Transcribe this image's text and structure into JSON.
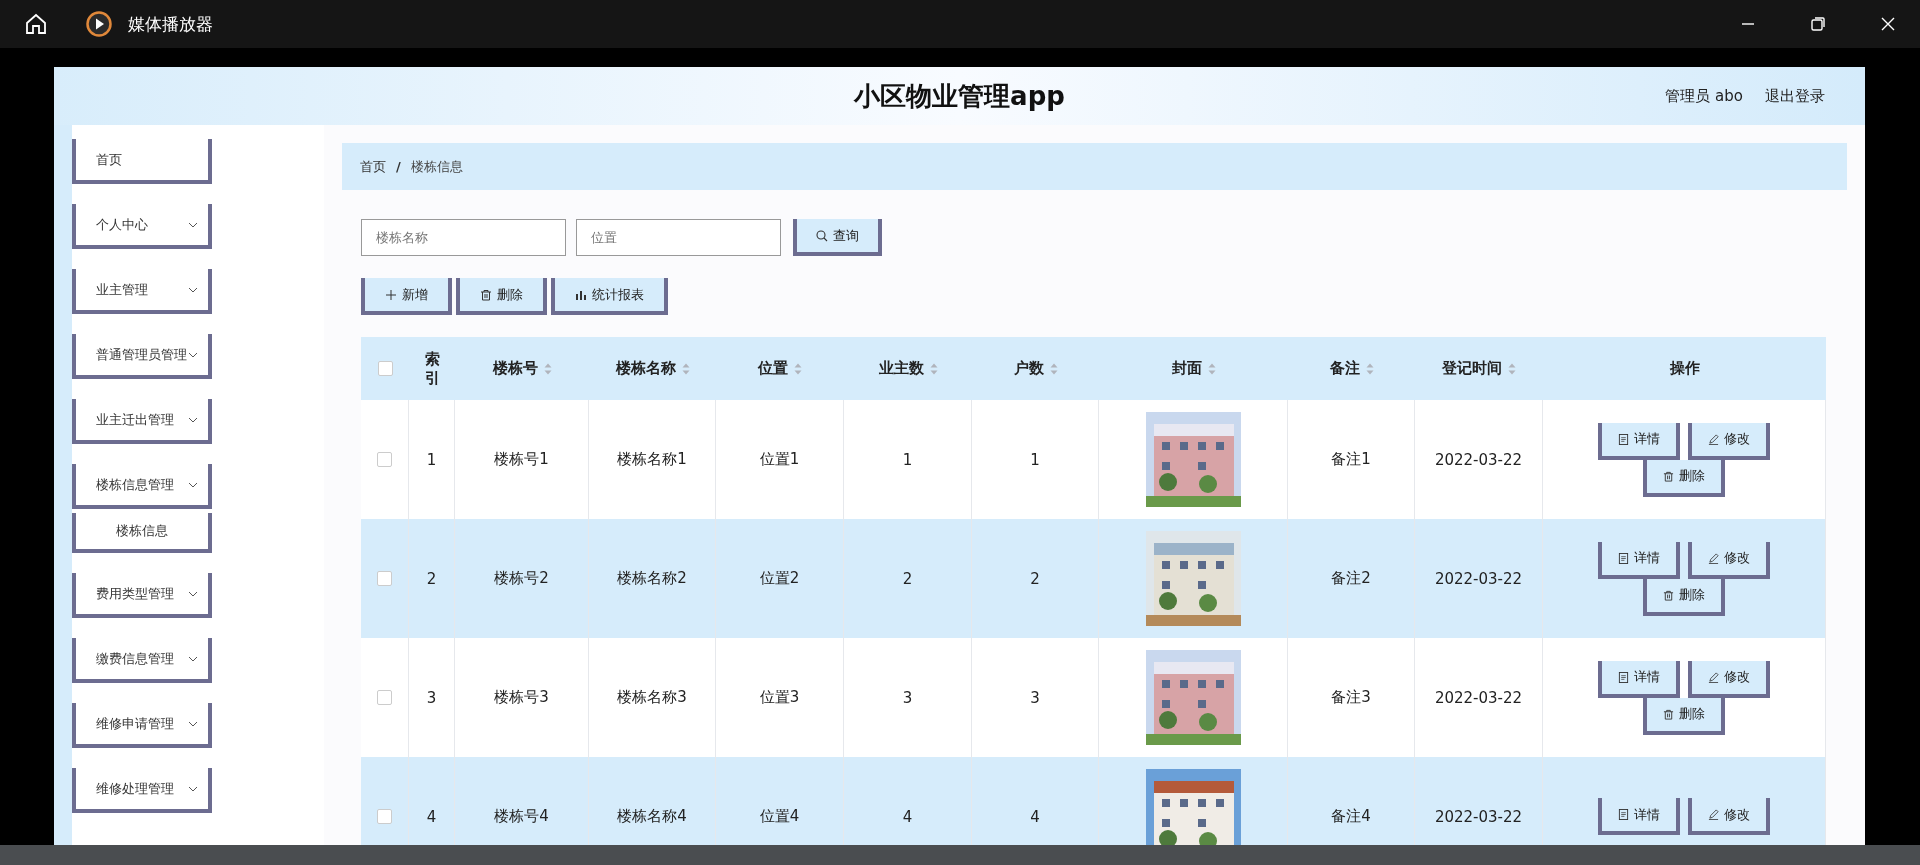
{
  "player": {
    "title": "媒体播放器"
  },
  "app": {
    "title": "小区物业管理app",
    "user": "管理员 abo",
    "logout": "退出登录"
  },
  "sidebar": {
    "items": [
      {
        "label": "首页",
        "kind": "link"
      },
      {
        "label": "个人中心",
        "kind": "menu"
      },
      {
        "label": "业主管理",
        "kind": "menu"
      },
      {
        "label": "普通管理员管理",
        "kind": "menu"
      },
      {
        "label": "业主迁出管理",
        "kind": "menu"
      },
      {
        "label": "楼栋信息管理",
        "kind": "menu",
        "children": [
          {
            "label": "楼栋信息"
          }
        ]
      },
      {
        "label": "费用类型管理",
        "kind": "menu"
      },
      {
        "label": "缴费信息管理",
        "kind": "menu"
      },
      {
        "label": "维修申请管理",
        "kind": "menu"
      },
      {
        "label": "维修处理管理",
        "kind": "menu"
      }
    ]
  },
  "breadcrumb": {
    "items": [
      "首页",
      "楼栋信息"
    ],
    "separator": "/"
  },
  "search": {
    "fields": [
      {
        "placeholder": "楼栋名称"
      },
      {
        "placeholder": "位置"
      }
    ],
    "button": "查询"
  },
  "toolbar": [
    {
      "label": "新增",
      "kind": "add"
    },
    {
      "label": "删除",
      "kind": "delete"
    },
    {
      "label": "统计报表",
      "kind": "chart"
    }
  ],
  "table": {
    "select_all": {
      "checked": false
    },
    "columns": [
      {
        "label": "索引",
        "sortable": false
      },
      {
        "label": "楼栋号",
        "sortable": true
      },
      {
        "label": "楼栋名称",
        "sortable": true
      },
      {
        "label": "位置",
        "sortable": true
      },
      {
        "label": "业主数",
        "sortable": true
      },
      {
        "label": "户数",
        "sortable": true
      },
      {
        "label": "封面",
        "sortable": true
      },
      {
        "label": "备注",
        "sortable": true
      },
      {
        "label": "登记时间",
        "sortable": true
      },
      {
        "label": "操作",
        "sortable": false
      }
    ],
    "rows": [
      {
        "checked": false,
        "cells": [
          "1",
          "楼栋号1",
          "楼栋名称1",
          "位置1",
          "1",
          "1"
        ],
        "cover": {
          "kind": "picture"
        },
        "note": "备注1",
        "date": "2022-03-22",
        "actions": [
          {
            "label": "详情",
            "kind": "detail"
          },
          {
            "label": "修改",
            "kind": "edit"
          },
          {
            "label": "删除",
            "kind": "delete"
          }
        ]
      },
      {
        "checked": false,
        "cells": [
          "2",
          "楼栋号2",
          "楼栋名称2",
          "位置2",
          "2",
          "2"
        ],
        "cover": {
          "kind": "picture"
        },
        "note": "备注2",
        "date": "2022-03-22",
        "actions": [
          {
            "label": "详情",
            "kind": "detail"
          },
          {
            "label": "修改",
            "kind": "edit"
          },
          {
            "label": "删除",
            "kind": "delete"
          }
        ]
      },
      {
        "checked": false,
        "cells": [
          "3",
          "楼栋号3",
          "楼栋名称3",
          "位置3",
          "3",
          "3"
        ],
        "cover": {
          "kind": "picture"
        },
        "note": "备注3",
        "date": "2022-03-22",
        "actions": [
          {
            "label": "详情",
            "kind": "detail"
          },
          {
            "label": "修改",
            "kind": "edit"
          },
          {
            "label": "删除",
            "kind": "delete"
          }
        ]
      },
      {
        "checked": false,
        "cells": [
          "4",
          "楼栋号4",
          "楼栋名称4",
          "位置4",
          "4",
          "4"
        ],
        "cover": {
          "kind": "picture"
        },
        "note": "备注4",
        "date": "2022-03-22",
        "actions": [
          {
            "label": "详情",
            "kind": "detail"
          },
          {
            "label": "修改",
            "kind": "edit"
          }
        ]
      }
    ]
  }
}
